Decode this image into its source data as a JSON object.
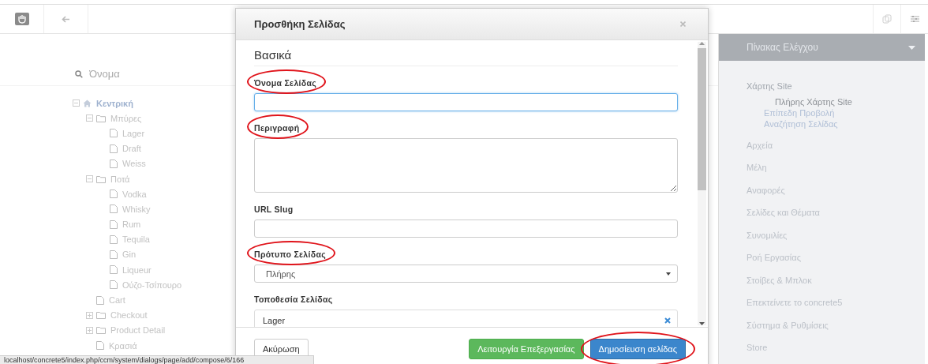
{
  "sitemap": {
    "search": {
      "placeholder": "Όνομα"
    },
    "tree": [
      {
        "label": "Κεντρική",
        "kind": "home",
        "expanded": true,
        "children": [
          {
            "label": "Μπύρες",
            "kind": "folder",
            "expanded": true,
            "children": [
              {
                "label": "Lager",
                "kind": "page"
              },
              {
                "label": "Draft",
                "kind": "page"
              },
              {
                "label": "Weiss",
                "kind": "page"
              }
            ]
          },
          {
            "label": "Ποτά",
            "kind": "folder",
            "expanded": true,
            "children": [
              {
                "label": "Vodka",
                "kind": "page"
              },
              {
                "label": "Whisky",
                "kind": "page"
              },
              {
                "label": "Rum",
                "kind": "page"
              },
              {
                "label": "Tequila",
                "kind": "page"
              },
              {
                "label": "Gin",
                "kind": "page"
              },
              {
                "label": "Liqueur",
                "kind": "page"
              },
              {
                "label": "Ούζο-Τσίπουρο",
                "kind": "page"
              }
            ]
          },
          {
            "label": "Cart",
            "kind": "page"
          },
          {
            "label": "Checkout",
            "kind": "folder",
            "expanded": false
          },
          {
            "label": "Product Detail",
            "kind": "folder",
            "expanded": false
          },
          {
            "label": "Κρασιά",
            "kind": "page"
          }
        ]
      }
    ]
  },
  "dialog": {
    "title": "Προσθήκη Σελίδας",
    "section": "Βασικά",
    "fields": [
      {
        "label": "Όνομα Σελίδας",
        "kind": "text",
        "circled": true,
        "focused": true
      },
      {
        "label": "Περιγραφή",
        "kind": "textarea",
        "circled": true,
        "focused": false
      },
      {
        "label": "URL Slug",
        "kind": "text",
        "circled": false,
        "focused": false
      },
      {
        "label": "Πρότυπο Σελίδας",
        "kind": "select",
        "value": "Πλήρης",
        "circled": true,
        "focused": false
      },
      {
        "label": "Τοποθεσία Σελίδας",
        "kind": "selector",
        "value": "Lager",
        "circled": false,
        "focused": false
      }
    ],
    "buttons": [
      {
        "label": "Ακύρωση",
        "kind": "default",
        "circled": false
      },
      {
        "label": "Λειτουργία Επεξεργασίας",
        "kind": "success",
        "circled": false
      },
      {
        "label": "Δημοσίευση σελίδας",
        "kind": "primary",
        "circled": true
      }
    ]
  },
  "panel": {
    "title": "Πίνακας Ελέγχου",
    "items": [
      {
        "label": "Χάρτης Site",
        "children": [
          {
            "label": "Πλήρης Χάρτης Site",
            "selected": true
          },
          {
            "label": "Επίπεδη Προβολή",
            "selected": false
          },
          {
            "label": "Αναζήτηση Σελίδας",
            "selected": false
          }
        ]
      },
      {
        "label": "Αρχεία"
      },
      {
        "label": "Μέλη"
      },
      {
        "label": "Αναφορές"
      },
      {
        "label": "Σελίδες και Θέματα"
      },
      {
        "label": "Συνομιλίες"
      },
      {
        "label": "Ροή Εργασίας"
      },
      {
        "label": "Στοίβες & Μπλοκ"
      },
      {
        "label": "Επεκτείνετε το concrete5"
      },
      {
        "label": "Σύστημα & Ρυθμίσεις"
      },
      {
        "label": "Store"
      }
    ]
  },
  "status_bar": "localhost/concrete5/index.php/ccm/system/dialogs/page/add/compose/6/166"
}
